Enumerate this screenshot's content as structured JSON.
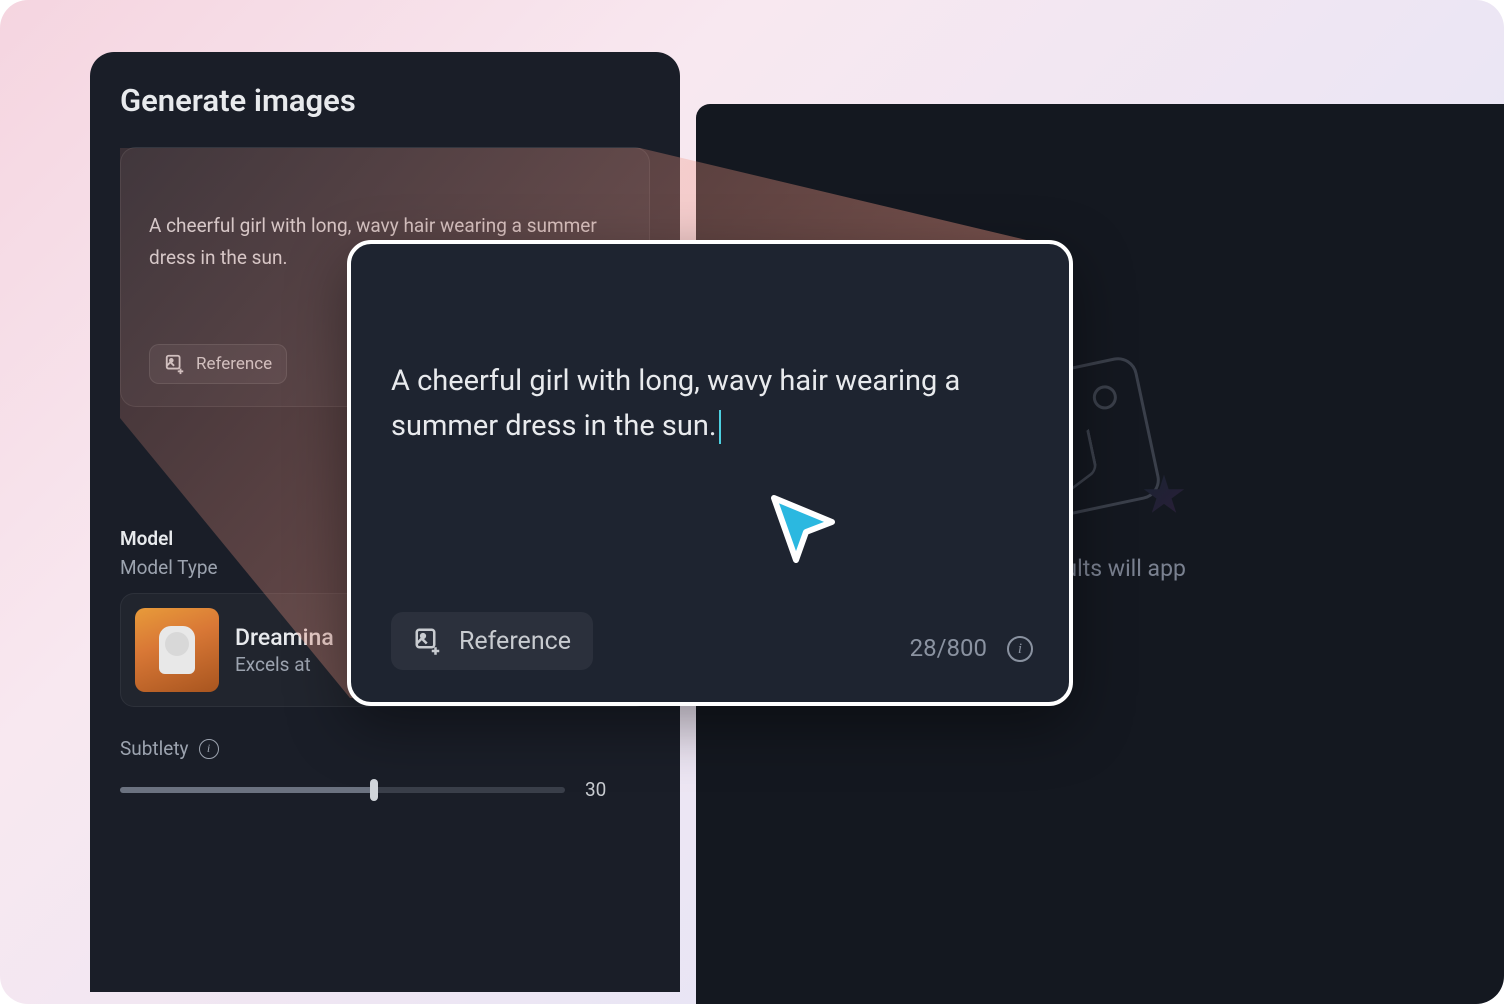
{
  "panel": {
    "title": "Generate images",
    "prompt_text": "A cheerful girl with long, wavy hair wearing a summer dress in the sun.",
    "reference_button": "Reference"
  },
  "model": {
    "section_label": "Model",
    "type_label": "Model Type",
    "name": "Dreamina",
    "description": "Excels at"
  },
  "subtlety": {
    "label": "Subtlety",
    "value": "30"
  },
  "results": {
    "placeholder": "d results will app"
  },
  "callout": {
    "prompt_text": "A cheerful girl with long, wavy hair wearing a summer dress in the sun.",
    "reference_button": "Reference",
    "char_count": "28/800"
  }
}
